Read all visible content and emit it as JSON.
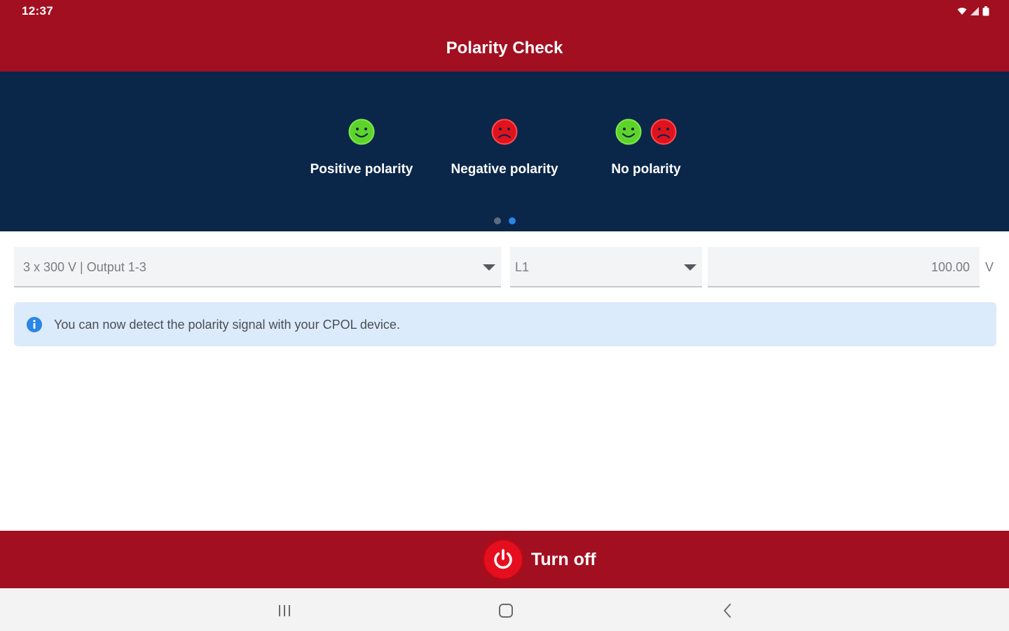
{
  "status_bar": {
    "time": "12:37",
    "icons": [
      "wifi-icon",
      "signal-icon",
      "battery-icon"
    ]
  },
  "app_bar": {
    "title": "Polarity Check"
  },
  "banner": {
    "legend": [
      {
        "label": "Positive polarity",
        "faces": [
          "happy"
        ]
      },
      {
        "label": "Negative polarity",
        "faces": [
          "sad"
        ]
      },
      {
        "label": "No polarity",
        "faces": [
          "happy",
          "sad"
        ]
      }
    ],
    "pager": {
      "count": 2,
      "active_index": 1
    }
  },
  "controls": {
    "output_select": {
      "value": "3 x 300 V | Output 1-3"
    },
    "phase_select": {
      "value": "L1"
    },
    "voltage_input": {
      "value": "100.00",
      "unit": "V"
    }
  },
  "info_message": {
    "text": "You can now detect the polarity signal with your CPOL device."
  },
  "footer": {
    "turn_off_label": "Turn off"
  },
  "nav_bar": {
    "buttons": [
      "recents",
      "home",
      "back"
    ]
  },
  "colors": {
    "brand_red": "#a20f20",
    "banner_navy": "#0a2649",
    "happy_green": "#5ed42b",
    "sad_red": "#e0121c",
    "info_bg": "#dcebfb",
    "info_blue": "#2a86e6"
  }
}
